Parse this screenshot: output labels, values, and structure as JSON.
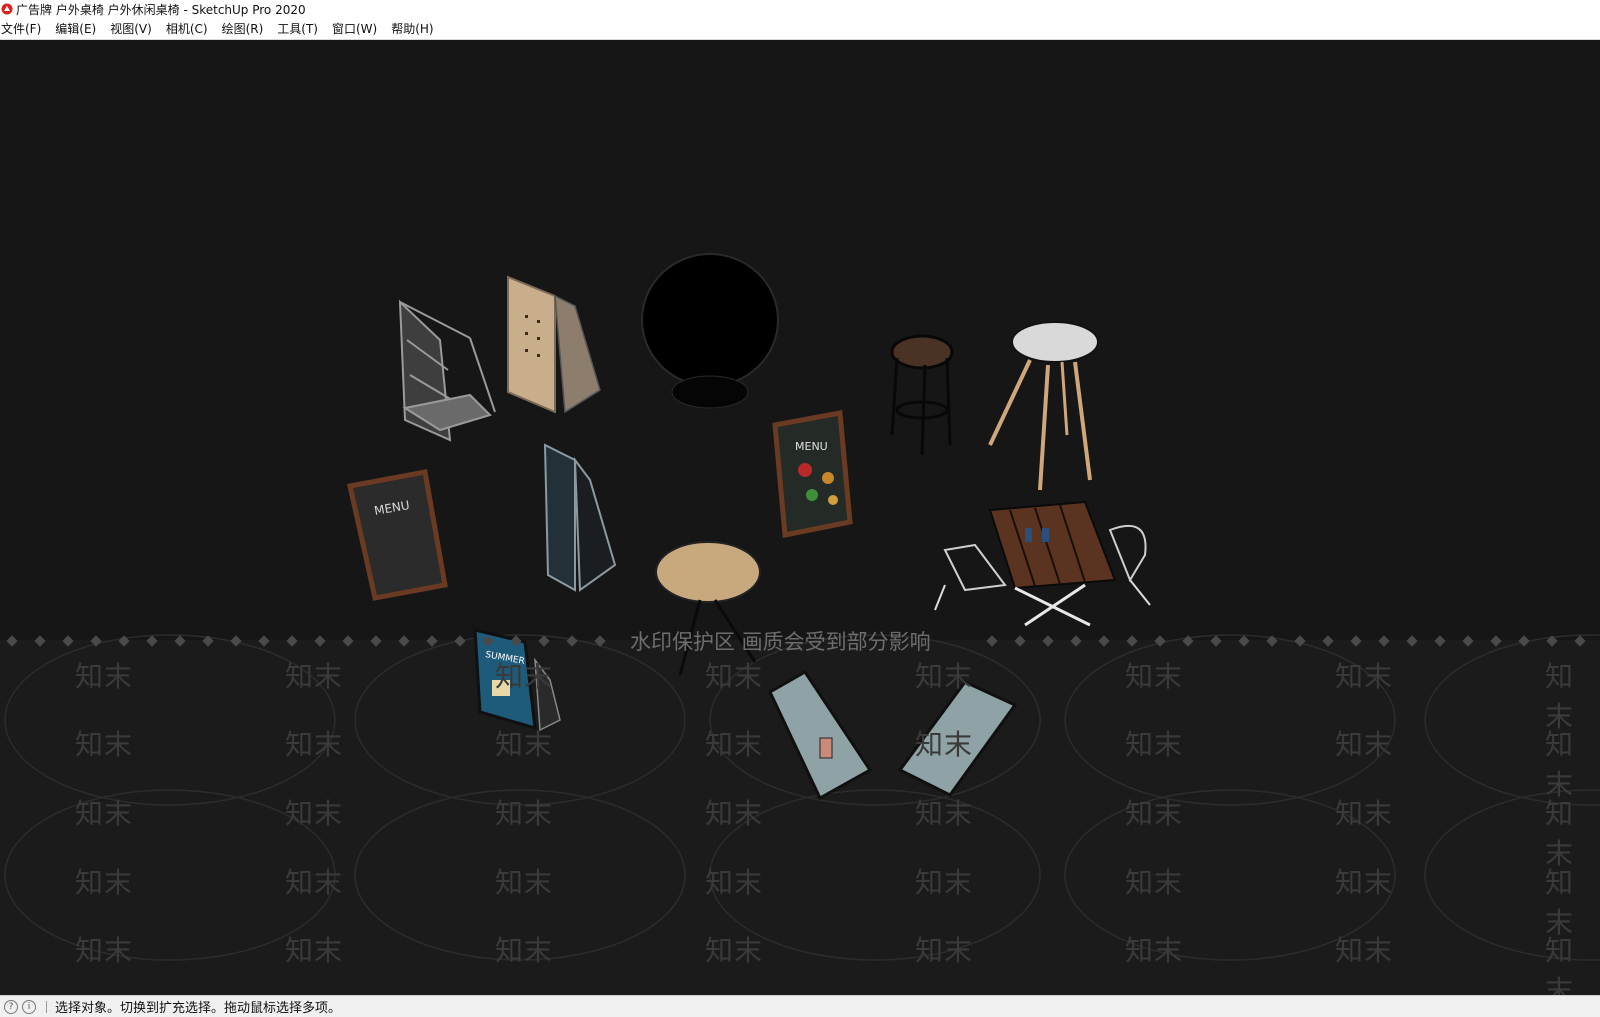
{
  "window": {
    "title": "广告牌 户外桌椅 户外休闲桌椅 - SketchUp Pro 2020"
  },
  "menu": {
    "items": [
      "文件(F)",
      "编辑(E)",
      "视图(V)",
      "相机(C)",
      "绘图(R)",
      "工具(T)",
      "窗口(W)",
      "帮助(H)"
    ]
  },
  "viewport": {
    "menu_board_text": "MENU",
    "poster_text": "SUMMER",
    "watermark_banner": "水印保护区 画质会受到部分影响",
    "watermark_word": "知末",
    "colors": {
      "background": "#161616",
      "wood": "#5a3420",
      "chalkboard": "#2a2a2a",
      "table_top": "#c8a97e"
    }
  },
  "status": {
    "message": "选择对象。切换到扩充选择。拖动鼠标选择多项。"
  }
}
